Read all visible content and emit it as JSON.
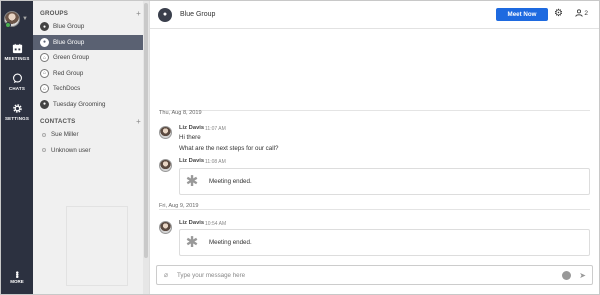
{
  "rail": {
    "meetings_label": "MEETINGS",
    "chats_label": "CHATS",
    "settings_label": "SETTINGS",
    "more_label": "MORE"
  },
  "sidebar": {
    "groups_heading": "GROUPS",
    "groups": [
      {
        "label": "Blue Group",
        "icon": "group-icon",
        "active": false
      },
      {
        "label": "Blue Group",
        "icon": "group-icon",
        "active": true
      },
      {
        "label": "Green Group",
        "icon": "lock-group-icon",
        "active": false
      },
      {
        "label": "Red Group",
        "icon": "lock-group-icon",
        "active": false
      },
      {
        "label": "TechDocs",
        "icon": "lock-group-icon",
        "active": false
      },
      {
        "label": "Tuesday Grooming",
        "icon": "group-icon",
        "active": false
      }
    ],
    "contacts_heading": "CONTACTS",
    "contacts": [
      {
        "label": "Sue Miller"
      },
      {
        "label": "Unknown user"
      }
    ]
  },
  "header": {
    "title": "Blue Group",
    "meet_now_label": "Meet Now",
    "participant_count": "2"
  },
  "messages": {
    "date1": "Thu, Aug 8, 2019",
    "m1": {
      "sender": "Liz Davis",
      "time": "11:07 AM",
      "line1": "Hi there",
      "line2": "What are the next steps for our call?"
    },
    "m2": {
      "sender": "Liz Davis",
      "time": "11:08 AM",
      "card": "Meeting ended."
    },
    "date2": "Fri, Aug 9, 2019",
    "m3": {
      "sender": "Liz Davis",
      "time": "10:54 AM",
      "card": "Meeting ended."
    }
  },
  "compose": {
    "placeholder": "Type your message here"
  },
  "colors": {
    "rail_bg": "#2c3140",
    "active_item_bg": "#5a6172",
    "meet_button": "#1e6ae0",
    "presence_online": "#4caf50"
  }
}
